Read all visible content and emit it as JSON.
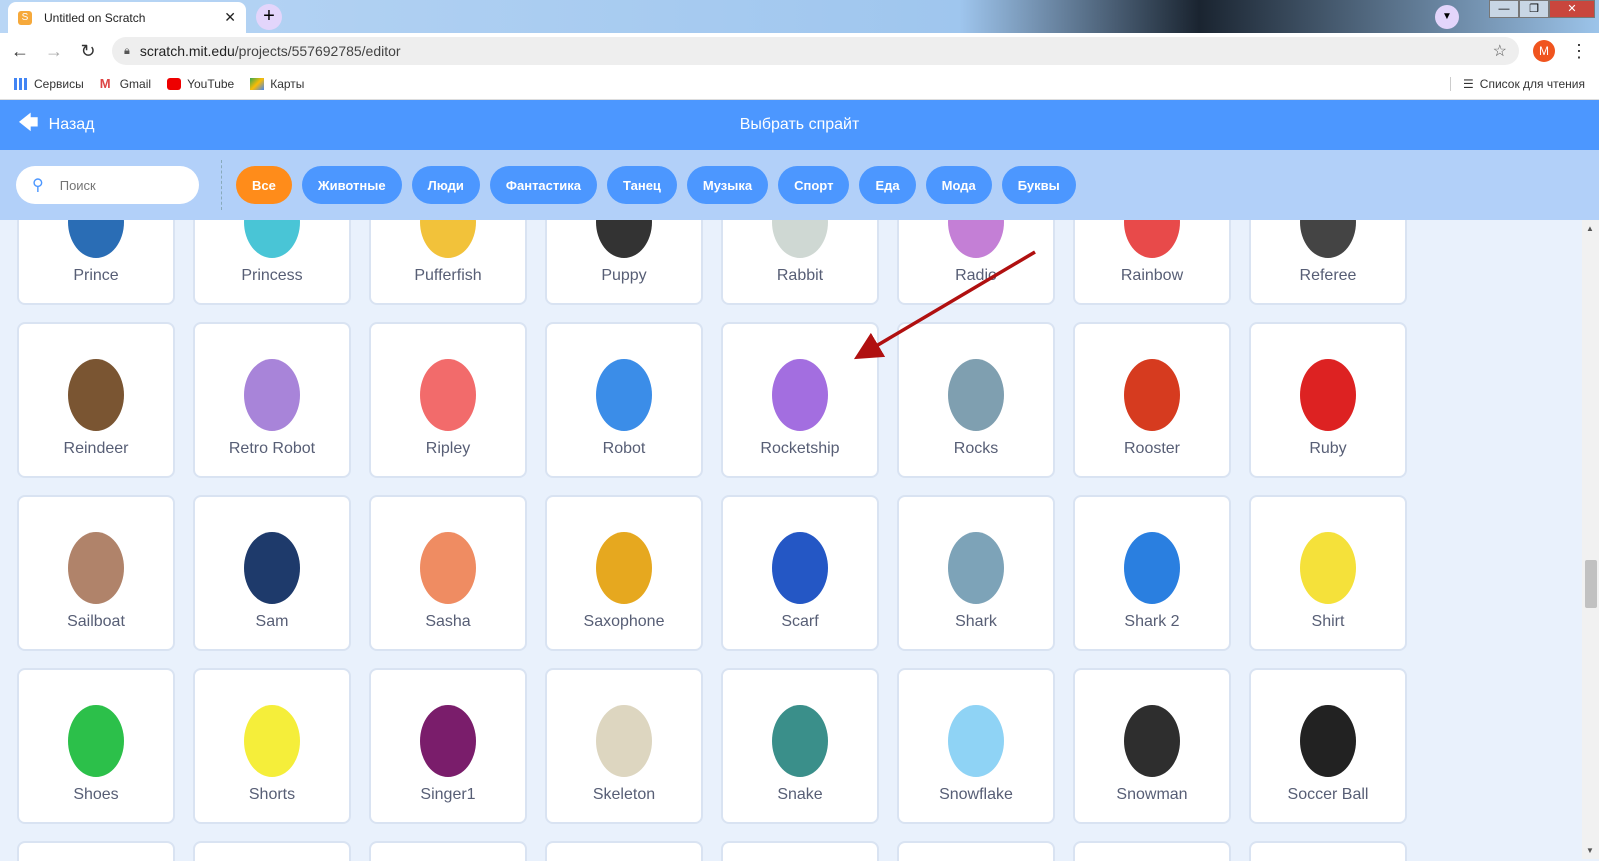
{
  "browser": {
    "tab_title": "Untitled on Scratch",
    "url_host": "scratch.mit.edu",
    "url_path": "/projects/557692785/editor",
    "profile_initial": "M",
    "bookmarks": [
      {
        "label": "Сервисы",
        "icon": "apps-grid-icon"
      },
      {
        "label": "Gmail",
        "icon": "gmail-icon"
      },
      {
        "label": "YouTube",
        "icon": "youtube-icon"
      },
      {
        "label": "Карты",
        "icon": "maps-icon"
      }
    ],
    "reading_list": "Список для чтения"
  },
  "header": {
    "back_label": "Назад",
    "title": "Выбрать спрайт"
  },
  "search": {
    "placeholder": "Поиск"
  },
  "categories": [
    "Все",
    "Животные",
    "Люди",
    "Фантастика",
    "Танец",
    "Музыка",
    "Спорт",
    "Еда",
    "Мода",
    "Буквы"
  ],
  "active_category": "Все",
  "sprites": [
    "Prince",
    "Princess",
    "Pufferfish",
    "Puppy",
    "Rabbit",
    "Radio",
    "Rainbow",
    "Referee",
    "Reindeer",
    "Retro Robot",
    "Ripley",
    "Robot",
    "Rocketship",
    "Rocks",
    "Rooster",
    "Ruby",
    "Sailboat",
    "Sam",
    "Sasha",
    "Saxophone",
    "Scarf",
    "Shark",
    "Shark 2",
    "Shirt",
    "Shoes",
    "Shorts",
    "Singer1",
    "Skeleton",
    "Snake",
    "Snowflake",
    "Snowman",
    "Soccer Ball"
  ],
  "colors": {
    "header": "#4c97ff",
    "filter_bar": "#b2d0f9",
    "active_pill": "#ff8c1a",
    "arrow": "#b01010"
  }
}
